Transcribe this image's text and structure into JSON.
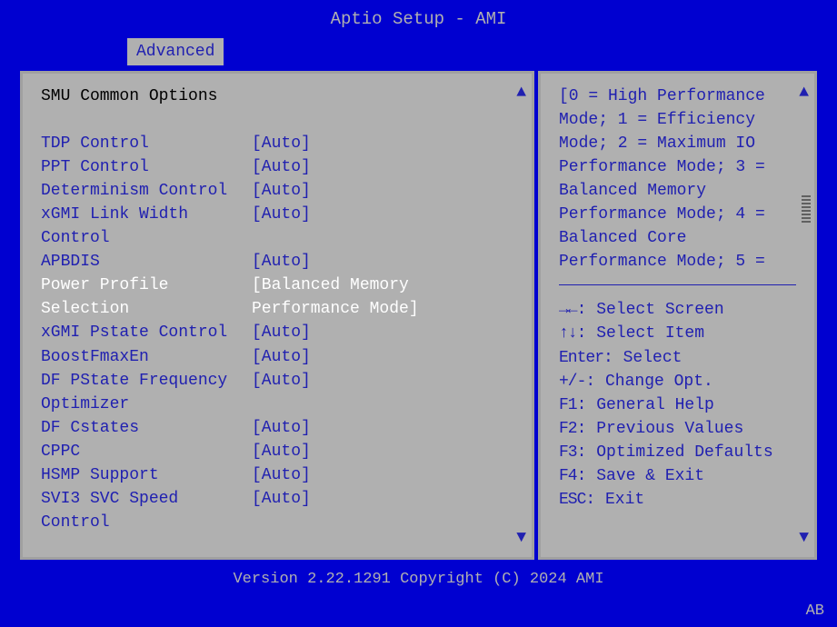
{
  "window": {
    "title": "Aptio Setup - AMI",
    "tab": "Advanced",
    "section_title": "SMU Common Options",
    "footer_version": "Version 2.22.1291 Copyright (C) 2024 AMI",
    "footer_badge": "AB"
  },
  "settings": [
    {
      "label": "TDP Control",
      "value": "[Auto]",
      "selected": false
    },
    {
      "label": "PPT Control",
      "value": "[Auto]",
      "selected": false
    },
    {
      "label": "Determinism Control",
      "value": "[Auto]",
      "selected": false
    },
    {
      "label": "xGMI Link Width",
      "label2": "Control",
      "value": "[Auto]",
      "selected": false
    },
    {
      "label": "APBDIS",
      "value": "[Auto]",
      "selected": false
    },
    {
      "label": "Power Profile",
      "label2": "Selection",
      "value": "[Balanced Memory",
      "value2": "Performance Mode]",
      "selected": true
    },
    {
      "label": "xGMI Pstate Control",
      "value": "[Auto]",
      "selected": false
    },
    {
      "label": "BoostFmaxEn",
      "value": "[Auto]",
      "selected": false
    },
    {
      "label": "DF PState Frequency",
      "label2": "Optimizer",
      "value": "[Auto]",
      "selected": false
    },
    {
      "label": "DF Cstates",
      "value": "[Auto]",
      "selected": false
    },
    {
      "label": "CPPC",
      "value": "[Auto]",
      "selected": false
    },
    {
      "label": "HSMP Support",
      "value": "[Auto]",
      "selected": false
    },
    {
      "label": "SVI3 SVC Speed Control",
      "value": "[Auto]",
      "selected": false
    }
  ],
  "help": {
    "lines": [
      "[0 = High Performance",
      "Mode; 1 = Efficiency",
      "Mode; 2 = Maximum IO",
      "Performance Mode; 3 =",
      "Balanced Memory",
      "Performance Mode; 4 =",
      "Balanced Core",
      "Performance Mode; 5 ="
    ]
  },
  "keys": [
    {
      "sym": "→←",
      "text": ": Select Screen"
    },
    {
      "sym": "↑↓",
      "text": ": Select Item"
    },
    {
      "sym": "Enter",
      "text": ": Select"
    },
    {
      "sym": "+/-",
      "text": ": Change Opt."
    },
    {
      "sym": "F1",
      "text": ": General Help"
    },
    {
      "sym": "F2",
      "text": ": Previous Values"
    },
    {
      "sym": "F3",
      "text": ": Optimized Defaults"
    },
    {
      "sym": "F4",
      "text": ": Save & Exit"
    },
    {
      "sym": "ESC",
      "text": ": Exit"
    }
  ],
  "glyphs": {
    "up": "▲",
    "down": "▼"
  }
}
